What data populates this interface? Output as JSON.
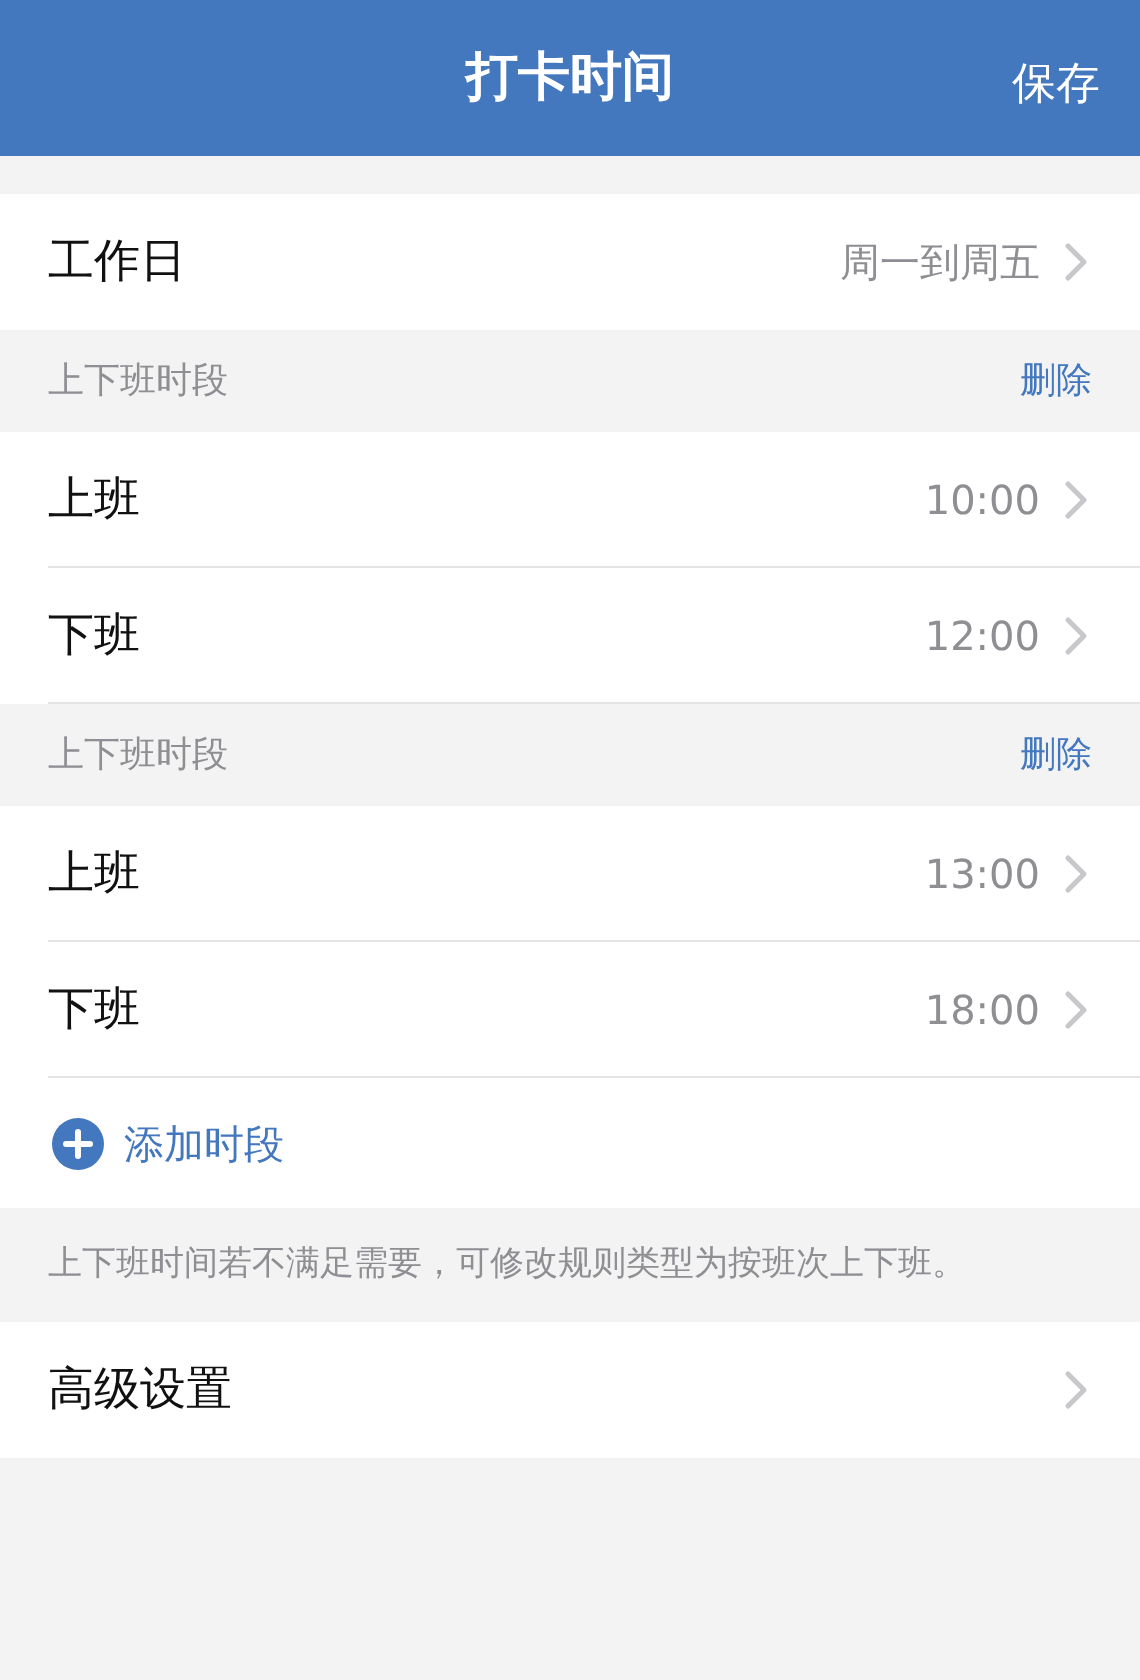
{
  "header": {
    "title": "打卡时间",
    "action": "保存"
  },
  "workdays": {
    "label": "工作日",
    "value": "周一到周五"
  },
  "periods": [
    {
      "label": "上下班时段",
      "delete": "删除",
      "rows": [
        {
          "label": "上班",
          "time": "10:00"
        },
        {
          "label": "下班",
          "time": "12:00"
        }
      ]
    },
    {
      "label": "上下班时段",
      "delete": "删除",
      "rows": [
        {
          "label": "上班",
          "time": "13:00"
        },
        {
          "label": "下班",
          "time": "18:00"
        }
      ]
    }
  ],
  "add_period": "添加时段",
  "note": "上下班时间若不满足需要，可修改规则类型为按班次上下班。",
  "advanced": {
    "label": "高级设置"
  }
}
